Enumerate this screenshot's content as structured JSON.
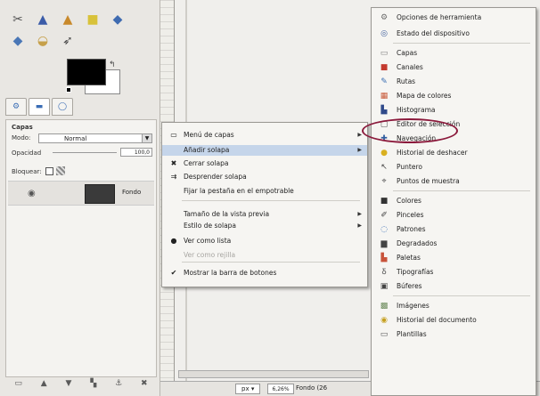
{
  "colors": {
    "highlight_ring": "#8b1a3c",
    "menu_highlight": "#c5d5ea",
    "menu_background": "#f6f5f2"
  },
  "toolbox": {
    "tools": [
      {
        "icon": "measure-tool-icon",
        "glyph": "✂",
        "color": "#555"
      },
      {
        "icon": "clone-tool-icon",
        "glyph": "▲",
        "color": "#3b5ca8"
      },
      {
        "icon": "heal-tool-icon",
        "glyph": "▲",
        "color": "#c8892b"
      },
      {
        "icon": "perspective-clone-icon",
        "glyph": "■",
        "color": "#d8c23a"
      },
      {
        "icon": "blur-tool-icon",
        "glyph": "◆",
        "color": "#3f6bb0"
      },
      {
        "icon": "smudge-tool-icon",
        "glyph": "◆",
        "color": "#4a77b6"
      },
      {
        "icon": "dodge-tool-icon",
        "glyph": "◒",
        "color": "#c6a04a"
      },
      {
        "icon": "ink-tool-icon",
        "glyph": "➶",
        "color": "#444"
      }
    ]
  },
  "layers_panel": {
    "title": "Capas",
    "mode_label": "Modo:",
    "mode_value": "Normal",
    "opacity_label": "Opacidad",
    "opacity_value": "100,0",
    "lock_label": "Bloquear:",
    "layer_name": "Fondo"
  },
  "statusbar": {
    "unit": "px",
    "zoom": "6,26%",
    "text": "Fondo (26"
  },
  "context_menu": {
    "items": [
      {
        "label": "Menú de capas",
        "icon": "tab-menu-icon",
        "glyph": "▭",
        "submenu": true
      },
      {
        "label": "Añadir solapa",
        "icon": "",
        "glyph": "",
        "submenu": true,
        "highlighted": true
      },
      {
        "label": "Cerrar solapa",
        "icon": "close-tab-icon",
        "glyph": "✖"
      },
      {
        "label": "Desprender solapa",
        "icon": "detach-tab-icon",
        "glyph": "⇉"
      },
      {
        "label": "Fijar la pestaña en el empotrable",
        "icon": "",
        "glyph": ""
      },
      {
        "label": "Tamaño de la vista previa",
        "icon": "",
        "glyph": "",
        "submenu": true
      },
      {
        "label": "Estilo de solapa",
        "icon": "",
        "glyph": "",
        "submenu": true
      },
      {
        "label": "Ver como lista",
        "icon": "radio-selected-icon",
        "glyph": "●"
      },
      {
        "label": "Ver como rejilla",
        "icon": "",
        "glyph": "",
        "disabled": true
      },
      {
        "label": "Mostrar la barra de botones",
        "icon": "checkmark-icon",
        "glyph": "✔"
      }
    ]
  },
  "submenu": {
    "items": [
      {
        "label": "Opciones de herramienta",
        "icon": "tool-options-icon",
        "glyph": "⚙",
        "color": "#6b6b6b"
      },
      {
        "label": "Estado del dispositivo",
        "icon": "device-status-icon",
        "glyph": "◎",
        "color": "#3c5c9a"
      },
      {
        "label": "Capas",
        "icon": "layers-icon",
        "glyph": "▭",
        "color": "#7d7d7d"
      },
      {
        "label": "Canales",
        "icon": "channels-icon",
        "glyph": "■",
        "color": "#c43a2e"
      },
      {
        "label": "Rutas",
        "icon": "paths-icon",
        "glyph": "✎",
        "color": "#3b6fb4"
      },
      {
        "label": "Mapa de colores",
        "icon": "colormap-icon",
        "glyph": "▦",
        "color": "#c85a3a"
      },
      {
        "label": "Histograma",
        "icon": "histogram-icon",
        "glyph": "▙",
        "color": "#304a8a"
      },
      {
        "label": "Editor de selección",
        "icon": "selection-editor-icon",
        "glyph": "▢",
        "color": "#555"
      },
      {
        "label": "Navegación",
        "icon": "navigation-icon",
        "glyph": "✚",
        "color": "#2f5d9f"
      },
      {
        "label": "Historial de deshacer",
        "icon": "undo-history-icon",
        "glyph": "●",
        "color": "#d9b020"
      },
      {
        "label": "Puntero",
        "icon": "pointer-icon",
        "glyph": "↖",
        "color": "#444"
      },
      {
        "label": "Puntos de muestra",
        "icon": "sample-points-icon",
        "glyph": "⌖",
        "color": "#555"
      },
      {
        "label": "Colores",
        "icon": "colors-icon",
        "glyph": "■",
        "color": "#333"
      },
      {
        "label": "Pinceles",
        "icon": "brushes-icon",
        "glyph": "✐",
        "color": "#444"
      },
      {
        "label": "Patrones",
        "icon": "patterns-icon",
        "glyph": "◌",
        "color": "#3b6fb4"
      },
      {
        "label": "Degradados",
        "icon": "gradients-icon",
        "glyph": "▆",
        "color": "#444"
      },
      {
        "label": "Paletas",
        "icon": "palettes-icon",
        "glyph": "▙",
        "color": "#c8533a"
      },
      {
        "label": "Tipografías",
        "icon": "fonts-icon",
        "glyph": "Ᵹ",
        "color": "#555"
      },
      {
        "label": "Búferes",
        "icon": "buffers-icon",
        "glyph": "▣",
        "color": "#444"
      },
      {
        "label": "Imágenes",
        "icon": "images-icon",
        "glyph": "▩",
        "color": "#6b8a5a"
      },
      {
        "label": "Historial del documento",
        "icon": "document-history-icon",
        "glyph": "◉",
        "color": "#c6a020"
      },
      {
        "label": "Plantillas",
        "icon": "templates-icon",
        "glyph": "▭",
        "color": "#555"
      }
    ]
  }
}
